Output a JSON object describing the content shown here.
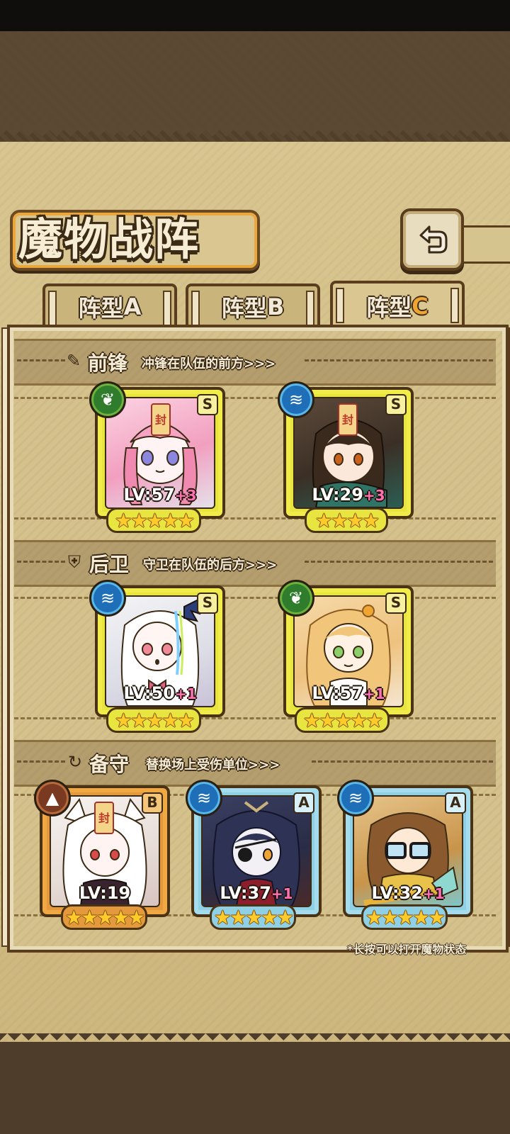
{
  "title": "魔物战阵",
  "tabs": [
    {
      "label": "阵型",
      "letter": "A",
      "active": false
    },
    {
      "label": "阵型",
      "letter": "B",
      "active": false
    },
    {
      "label": "阵型",
      "letter": "C",
      "active": true
    }
  ],
  "sections": [
    {
      "title": "前锋",
      "description": "冲锋在队伍的前方>>>",
      "icon": "sword-icon"
    },
    {
      "title": "后卫",
      "description": "守卫在队伍的后方>>>",
      "icon": "shield-icon"
    },
    {
      "title": "备守",
      "description": "替换场上受伤单位>>>",
      "icon": "swap-icon"
    }
  ],
  "front": [
    {
      "level": "LV:57",
      "plus": "+3",
      "rank": "S",
      "element": "leaf",
      "stars": "★★★★★",
      "portrait": "pink-hair-girl"
    },
    {
      "level": "LV:29",
      "plus": "+3",
      "rank": "S",
      "element": "water",
      "stars": "★★★★",
      "portrait": "dark-hair-girl"
    }
  ],
  "back": [
    {
      "level": "LV:50",
      "plus": "+1",
      "rank": "S",
      "element": "water",
      "stars": "★★★★★",
      "portrait": "white-hair-girl"
    },
    {
      "level": "LV:57",
      "plus": "+1",
      "rank": "S",
      "element": "leaf",
      "stars": "★★★★★",
      "portrait": "blonde-girl"
    }
  ],
  "reserve": [
    {
      "level": "LV:19",
      "plus": "",
      "rank": "B",
      "element": "earth",
      "stars": "★★★★★",
      "portrait": "white-fox-girl"
    },
    {
      "level": "LV:37",
      "plus": "+1",
      "rank": "A",
      "element": "water",
      "stars": "★★★★★",
      "portrait": "eyepatch-girl"
    },
    {
      "level": "LV:32",
      "plus": "+1",
      "rank": "A",
      "element": "water",
      "stars": "★★★★★",
      "portrait": "glasses-girl"
    }
  ],
  "hint": "*长按可以打开魔物状态",
  "colors": {
    "rank_s": "#e8e540",
    "rank_a": "#8fd0e4",
    "rank_b": "#e49a3c",
    "leaf": "#2f7d2c",
    "water": "#1f6fb8",
    "earth": "#7a3a22"
  }
}
